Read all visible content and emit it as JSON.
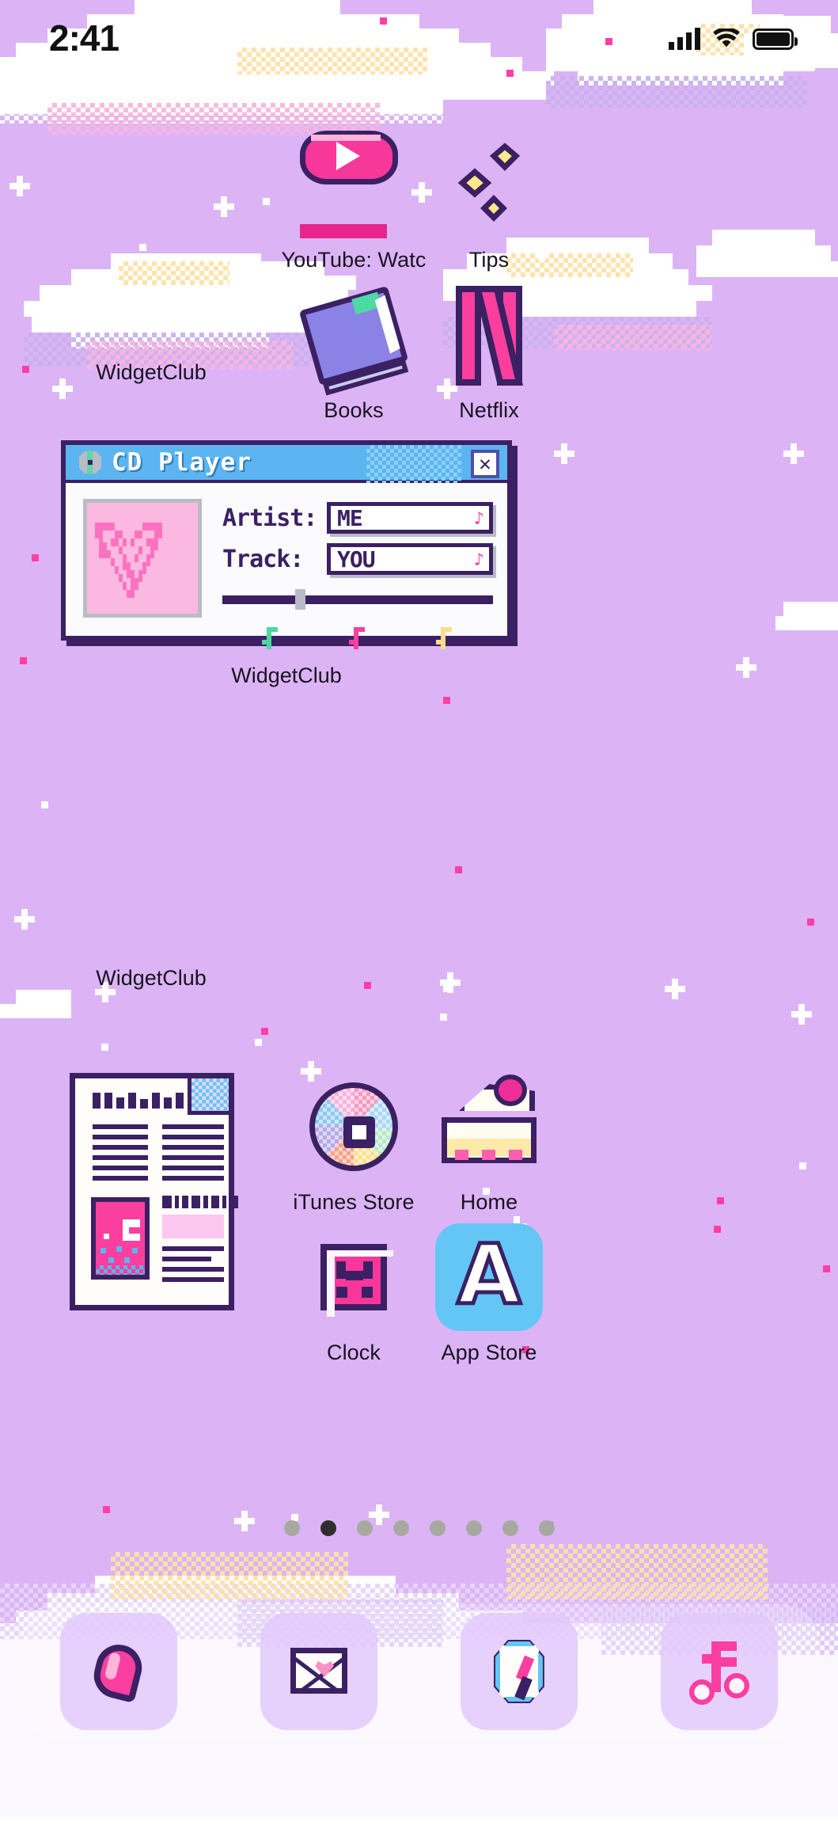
{
  "status_bar": {
    "time": "2:41",
    "signal_icon": "cellular-signal-icon",
    "wifi_icon": "wifi-icon",
    "battery_icon": "battery-icon"
  },
  "home_screen": {
    "apps": [
      {
        "label": "YouTube: Watc",
        "icon": "youtube-icon"
      },
      {
        "label": "Tips",
        "icon": "tips-sparkles-icon"
      },
      {
        "label": "WidgetClub",
        "icon": "widgetclub-widget"
      },
      {
        "label": "Books",
        "icon": "books-icon"
      },
      {
        "label": "Netflix",
        "icon": "netflix-icon"
      },
      {
        "label": "WidgetClub",
        "icon": "cd-player-widget"
      },
      {
        "label": "WidgetClub",
        "icon": "newspaper-widget"
      },
      {
        "label": "iTunes Store",
        "icon": "itunes-cd-icon"
      },
      {
        "label": "Home",
        "icon": "cake-icon"
      },
      {
        "label": "Clock",
        "icon": "clock-icon"
      },
      {
        "label": "App Store",
        "icon": "app-store-icon"
      }
    ],
    "page_dots": {
      "count": 8,
      "active_index": 1
    }
  },
  "cd_player_widget": {
    "title": "CD Player",
    "title_icon": "cd-disc-icon",
    "close_label": "✕",
    "album_art": "pixel-heart-album-art",
    "fields": [
      {
        "label": "Artist:",
        "value": "ME"
      },
      {
        "label": "Track:",
        "value": "YOU"
      }
    ],
    "progress_percent": 27,
    "notes": [
      {
        "name": "music-note-green",
        "color": "#4fd6a0"
      },
      {
        "name": "music-note-pink",
        "color": "#fb3fa0"
      },
      {
        "name": "music-note-yellow",
        "color": "#f9dd8a"
      }
    ]
  },
  "widget_labels": {
    "top_left": "WidgetClub",
    "cd_player": "WidgetClub",
    "newspaper": "WidgetClub"
  },
  "dock": {
    "items": [
      {
        "label": "Phone",
        "icon": "phone-icon"
      },
      {
        "label": "Mail",
        "icon": "mail-icon"
      },
      {
        "label": "Safari",
        "icon": "compass-icon"
      },
      {
        "label": "Music",
        "icon": "music-note-icon"
      }
    ]
  },
  "theme": {
    "background": "#dcb4f5",
    "pixel_outline": "#3b2063",
    "accent_pink": "#fa3f9f",
    "accent_blue": "#63c6f5",
    "cloud_white": "#ffffff"
  }
}
